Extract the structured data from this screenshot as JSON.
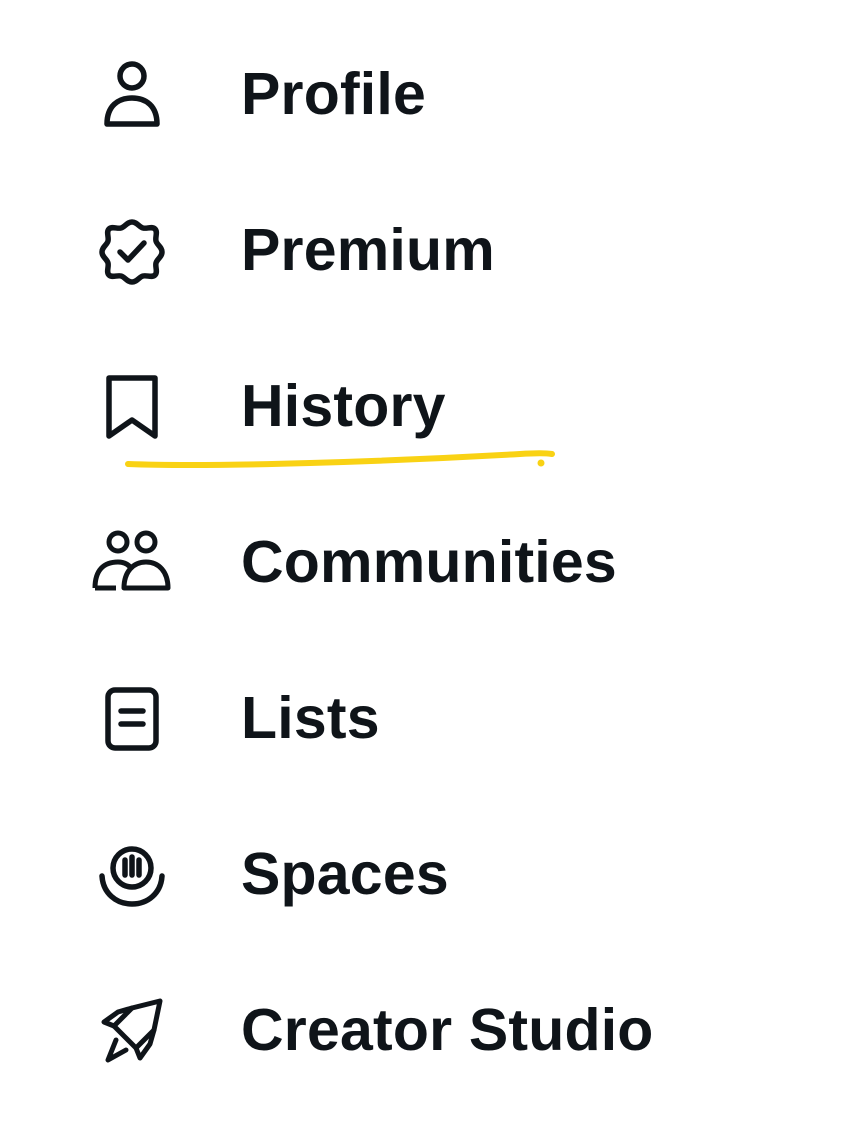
{
  "menu": {
    "items": [
      {
        "label": "Profile",
        "icon": "person-icon"
      },
      {
        "label": "Premium",
        "icon": "verified-badge-icon"
      },
      {
        "label": "History",
        "icon": "bookmark-icon"
      },
      {
        "label": "Communities",
        "icon": "people-icon"
      },
      {
        "label": "Lists",
        "icon": "list-document-icon"
      },
      {
        "label": "Spaces",
        "icon": "microphone-spaces-icon"
      },
      {
        "label": "Creator Studio",
        "icon": "rocket-icon"
      }
    ],
    "highlight": {
      "item": "History",
      "color": "#f9d214"
    },
    "text_color": "#0f1419"
  }
}
